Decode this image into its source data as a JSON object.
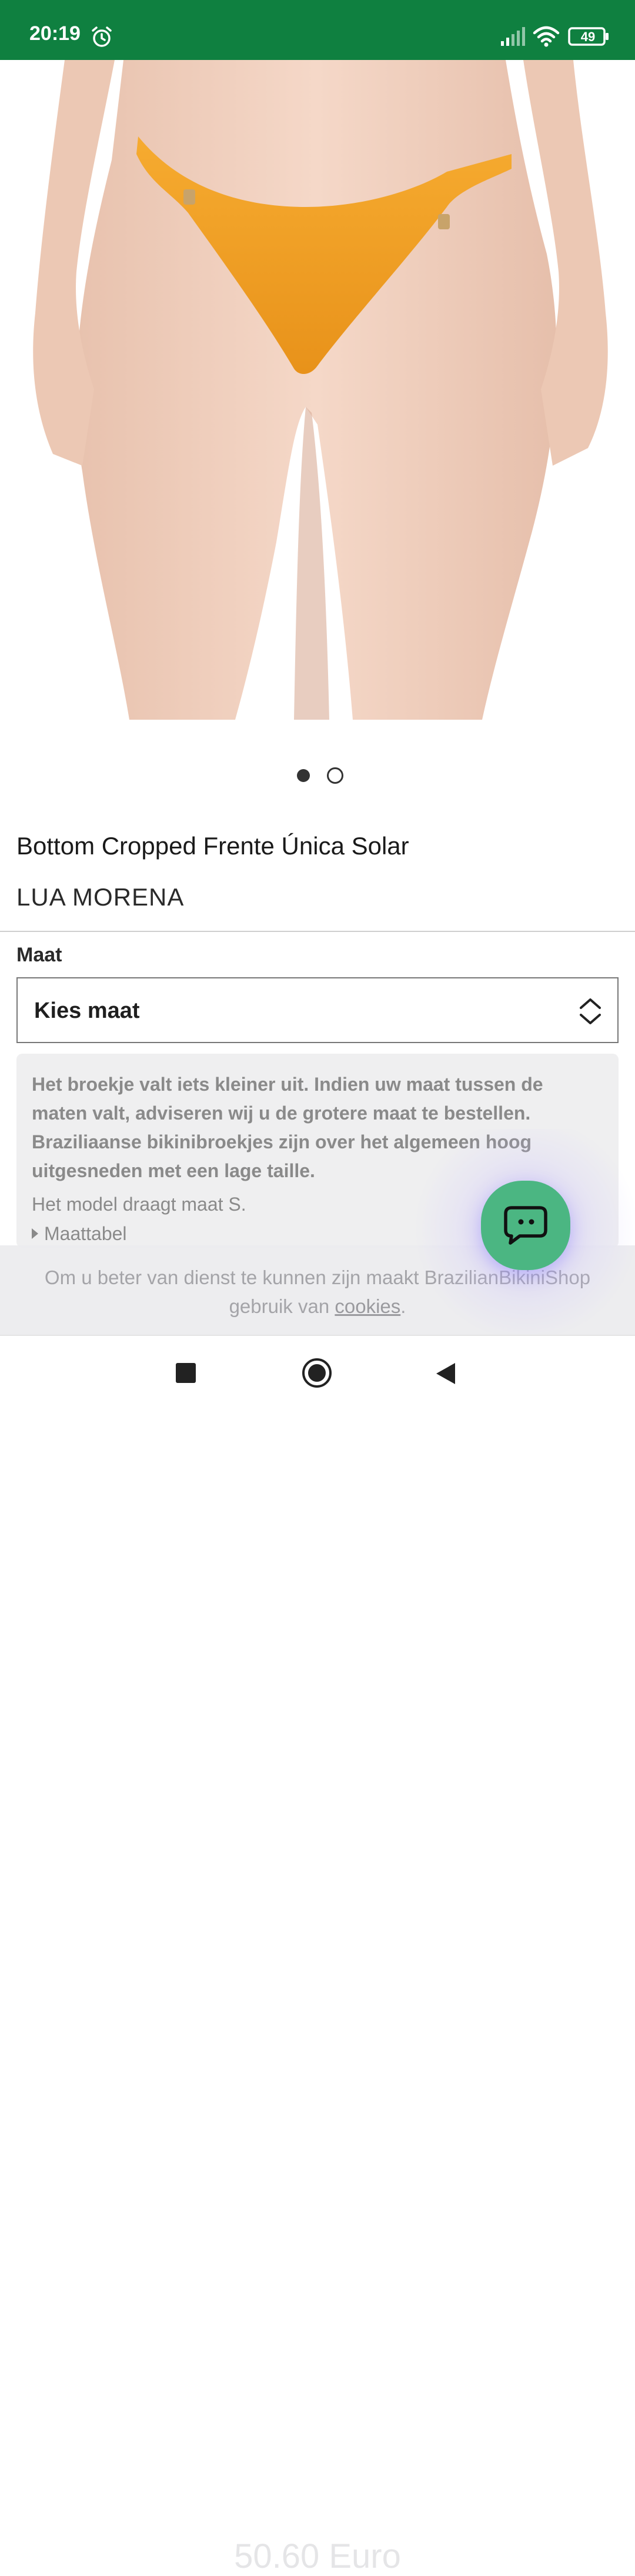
{
  "status_bar": {
    "time": "20:19",
    "battery": "49",
    "icons": [
      "alarm-icon",
      "signal-icon",
      "wifi-icon",
      "battery-icon"
    ]
  },
  "product": {
    "title": "Bottom Cropped Frente Única Solar",
    "brand": "LUA MORENA",
    "image_count": 2,
    "active_image": 1
  },
  "size": {
    "label": "Maat",
    "select_value": "Kies maat"
  },
  "info": {
    "bold_text": "Het broekje valt iets kleiner uit. Indien uw maat tussen de maten valt, adviseren wij u de grotere maat te bestellen. Braziliaanse bikinibroekjes zijn over het algemeen hoog uitgesneden met een lage taille.",
    "model_text": "Het model draagt maat S.",
    "size_chart_label": "Maattabel"
  },
  "cookie": {
    "text_before": "Om u beter van dienst te kunnen zijn maakt BrazilianBikiniShop gebruik van ",
    "link": "cookies",
    "text_after": "."
  },
  "price": "50.60 Euro",
  "colors": {
    "status_bar": "#0f8040",
    "chat_button": "#4bb682",
    "bikini": "#f3a02a"
  }
}
